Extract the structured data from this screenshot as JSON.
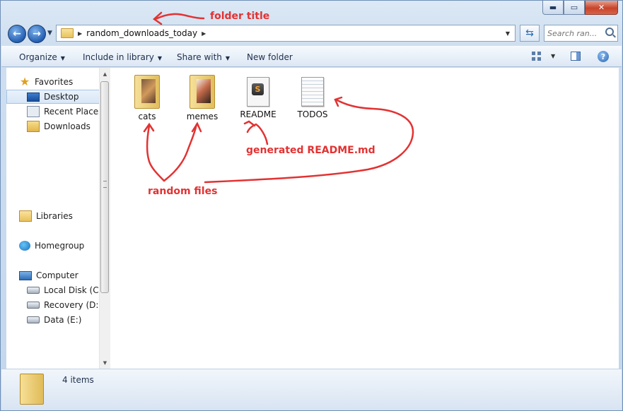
{
  "window": {
    "controls": {
      "minimize": "▬",
      "maximize": "▭",
      "close": "✕"
    }
  },
  "nav": {
    "back_icon": "arrow-left-icon",
    "forward_icon": "arrow-right-icon",
    "breadcrumb": [
      "random_downloads_today"
    ],
    "search_placeholder": "Search ran..."
  },
  "commands": {
    "organize": "Organize",
    "include_in_library": "Include in library",
    "share_with": "Share with",
    "new_folder": "New folder"
  },
  "sidebar": {
    "favorites": {
      "label": "Favorites",
      "items": [
        "Desktop",
        "Recent Places",
        "Downloads"
      ],
      "selected": "Desktop"
    },
    "libraries": "Libraries",
    "homegroup": "Homegroup",
    "computer": {
      "label": "Computer",
      "items": [
        "Local Disk (C:)",
        "Recovery (D:)",
        "Data (E:)"
      ]
    }
  },
  "files": [
    {
      "name": "cats",
      "type": "folder",
      "icon": "folder-icon"
    },
    {
      "name": "memes",
      "type": "folder",
      "icon": "folder-icon"
    },
    {
      "name": "README",
      "type": "file",
      "icon": "sublime-text-file-icon"
    },
    {
      "name": "TODOS",
      "type": "file",
      "icon": "text-file-icon"
    }
  ],
  "annotations": {
    "folder_title": "folder title",
    "generated_readme": "generated  README.md",
    "random_files": "random files",
    "color": "#e33232"
  },
  "status": {
    "item_count": "4 items"
  }
}
